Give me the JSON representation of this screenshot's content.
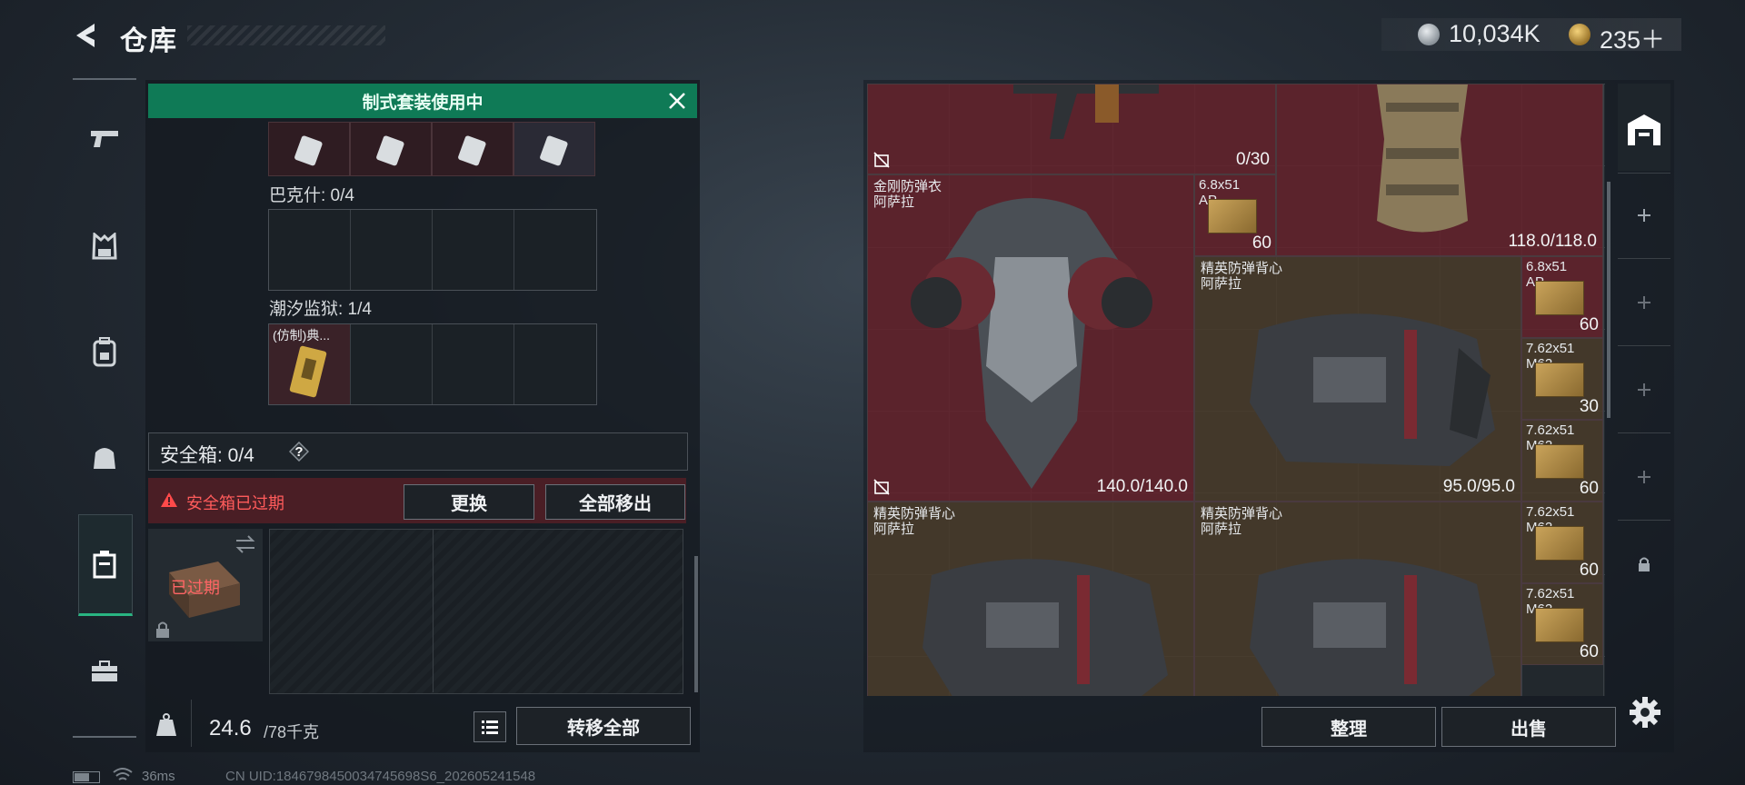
{
  "header": {
    "title": "仓库",
    "currency": [
      {
        "icon": "silver-coin-icon",
        "value": "10,034K"
      },
      {
        "icon": "gold-coin-icon",
        "value": "235＋"
      }
    ]
  },
  "left_nav": {
    "items": [
      {
        "icon": "pistol-icon"
      },
      {
        "icon": "vest-icon"
      },
      {
        "icon": "backpack-icon"
      },
      {
        "icon": "bag-icon"
      },
      {
        "icon": "case-icon",
        "active": true
      },
      {
        "icon": "toolbox-icon"
      }
    ]
  },
  "loadout": {
    "banner": "制式套装使用中",
    "sections": [
      {
        "label": "巴克什: 0/4"
      },
      {
        "label": "潮汐监狱: 1/4",
        "item_label": "(仿制)典..."
      }
    ],
    "safe_box": {
      "label": "安全箱: 0/4",
      "help": "?"
    },
    "expired": {
      "text": "安全箱已过期",
      "replace_button": "更换",
      "move_all_button": "全部移出",
      "case_text": "已过期"
    },
    "weight": {
      "value": "24.6",
      "unit": "/78千克"
    },
    "transfer_button": "转移全部"
  },
  "status_bar": {
    "ping": "36ms",
    "uid": "CN UID:1846798450034745698S6_202605241548"
  },
  "storage": {
    "items": [
      {
        "id": "rifle",
        "name": "",
        "value": "0/30",
        "color": "red"
      },
      {
        "id": "chest",
        "name": "",
        "value": "118.0/118.0",
        "color": "red"
      },
      {
        "id": "armor-king",
        "name": "金刚防弹衣\n阿萨拉",
        "value": "140.0/140.0",
        "color": "red"
      },
      {
        "id": "ammo-1",
        "name": "6.8x51\nAP",
        "value": "60"
      },
      {
        "id": "vest-1",
        "name": "精英防弹背心\n阿萨拉",
        "value": "95.0/95.0",
        "color": "tan"
      },
      {
        "id": "ammo-2",
        "name": "6.8x51\nAP",
        "value": "60"
      },
      {
        "id": "ammo-3",
        "name": "7.62x51\nM62",
        "value": "30"
      },
      {
        "id": "ammo-4",
        "name": "7.62x51\nM62",
        "value": "60"
      },
      {
        "id": "vest-2",
        "name": "精英防弹背心\n阿萨拉",
        "value": "",
        "color": "tan"
      },
      {
        "id": "vest-3",
        "name": "精英防弹背心\n阿萨拉",
        "value": "",
        "color": "tan"
      },
      {
        "id": "ammo-5",
        "name": "7.62x51\nM62",
        "value": "60"
      },
      {
        "id": "ammo-6",
        "name": "7.62x51\nM62",
        "value": "60"
      }
    ],
    "sort_button": "整理",
    "sell_button": "出售"
  },
  "right_rail": {
    "items": [
      {
        "icon": "storage-icon"
      },
      {
        "icon": "plus-icon"
      },
      {
        "icon": "plus-icon"
      },
      {
        "icon": "plus-icon"
      },
      {
        "icon": "plus-icon"
      },
      {
        "icon": "lock-icon"
      }
    ]
  }
}
